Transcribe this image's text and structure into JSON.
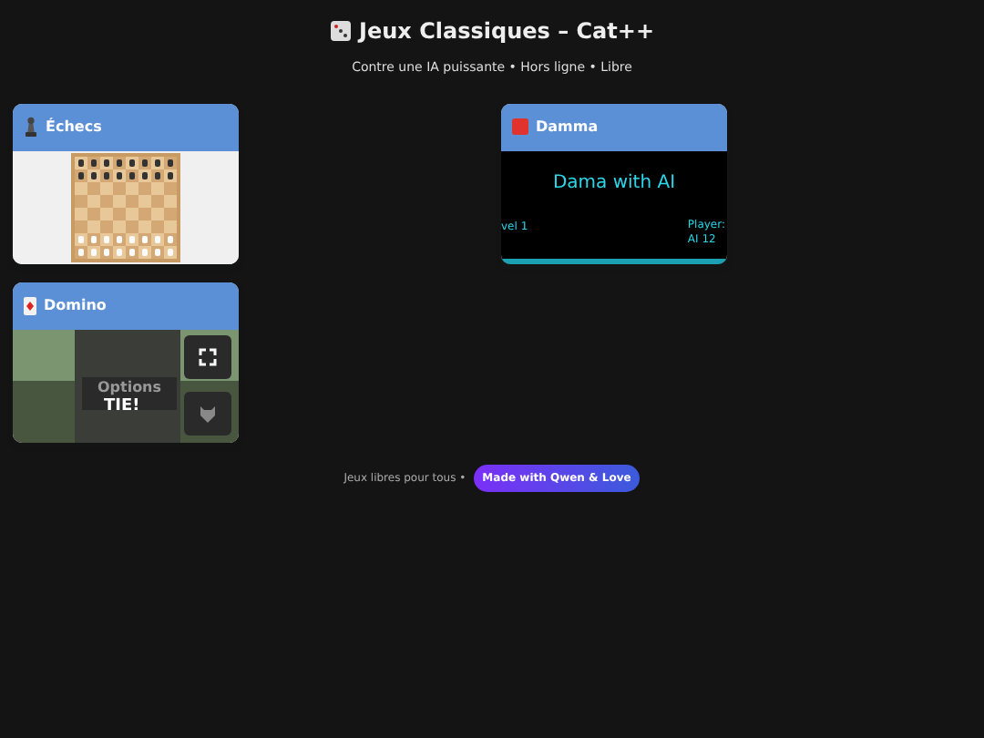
{
  "header": {
    "title": "Jeux Classiques – Cat++",
    "subtitle": "Contre une IA puissante • Hors ligne • Libre"
  },
  "games": [
    {
      "kind": "chess",
      "title": "Échecs"
    },
    {
      "kind": "damma",
      "title": "Damma",
      "preview": {
        "heading": "Dama with AI",
        "left": "vel 1",
        "right_top": "Player:",
        "right_bottom": "AI 12"
      }
    },
    {
      "kind": "domino",
      "title": "Domino",
      "preview": {
        "menu_top": "Options",
        "result": "TIE!"
      }
    }
  ],
  "footer": {
    "text": "Jeux libres pour tous •",
    "badge": "Made with Qwen & Love"
  }
}
